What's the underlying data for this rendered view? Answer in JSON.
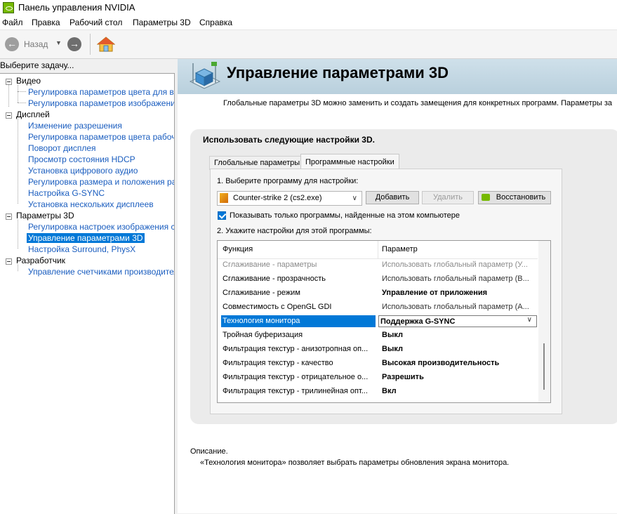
{
  "window": {
    "title": "Панель управления NVIDIA"
  },
  "menu": [
    "Файл",
    "Правка",
    "Рабочий стол",
    "Параметры 3D",
    "Справка"
  ],
  "toolbar": {
    "back_label": "Назад"
  },
  "sidebar": {
    "task_label": "Выберите задачу...",
    "categories": [
      {
        "label": "Видео",
        "items": [
          "Регулировка параметров цвета для вид",
          "Регулировка параметров изображения д"
        ]
      },
      {
        "label": "Дисплей",
        "items": [
          "Изменение разрешения",
          "Регулировка параметров цвета рабочег",
          "Поворот дисплея",
          "Просмотр состояния HDCP",
          "Установка цифрового аудио",
          "Регулировка размера и положения рабо",
          "Настройка G-SYNC",
          "Установка нескольких дисплеев"
        ]
      },
      {
        "label": "Параметры 3D",
        "items": [
          "Регулировка настроек изображения с пр",
          "Управление параметрами 3D",
          "Настройка Surround, PhysX"
        ]
      },
      {
        "label": "Разработчик",
        "items": [
          "Управление счетчиками производитель"
        ]
      }
    ],
    "selected_item": "Управление параметрами 3D"
  },
  "main": {
    "title": "Управление параметрами 3D",
    "intro": "Глобальные параметры 3D можно заменить и создать замещения для конкретных программ. Параметры за",
    "panel_heading": "Использовать следующие настройки 3D.",
    "tabs": [
      {
        "label": "Глобальные параметры",
        "active": false
      },
      {
        "label": "Программные настройки",
        "active": true
      }
    ],
    "step1": "1. Выберите программу для настройки:",
    "program_select": "Counter-strike 2 (cs2.exe)",
    "add_button": "Добавить",
    "remove_button": "Удалить",
    "restore_button": "Восстановить",
    "checkbox_label": "Показывать только программы, найденные на этом компьютере",
    "checkbox_checked": true,
    "step2": "2. Укажите настройки для этой программы:",
    "grid": {
      "headers": [
        "Функция",
        "Параметр"
      ],
      "rows": [
        {
          "feature": "Сглаживание - параметры",
          "value": "Использовать глобальный параметр (У...",
          "style": "muted"
        },
        {
          "feature": "Сглаживание - прозрачность",
          "value": "Использовать глобальный параметр (В...",
          "style": "global"
        },
        {
          "feature": "Сглаживание - режим",
          "value": "Управление от приложения",
          "style": "bold"
        },
        {
          "feature": "Совместимость с OpenGL GDI",
          "value": "Использовать глобальный параметр (А...",
          "style": "global"
        },
        {
          "feature": "Технология монитора",
          "value": "Поддержка G-SYNC",
          "style": "selected"
        },
        {
          "feature": "Тройная буферизация",
          "value": "Выкл",
          "style": "bold"
        },
        {
          "feature": "Фильтрация текстур - анизотропная оп...",
          "value": "Выкл",
          "style": "bold"
        },
        {
          "feature": "Фильтрация текстур - качество",
          "value": "Высокая производительность",
          "style": "bold"
        },
        {
          "feature": "Фильтрация текстур - отрицательное о...",
          "value": "Разрешить",
          "style": "bold"
        },
        {
          "feature": "Фильтрация текстур - трилинейная опт...",
          "value": "Вкл",
          "style": "bold"
        }
      ]
    },
    "description_title": "Описание.",
    "description_text": "«Технология монитора» позволяет выбрать параметры обновления экрана монитора."
  },
  "colors": {
    "accent": "#0078d7",
    "link": "#1a5dbf",
    "nvidia_green": "#76b900",
    "header_band": "#c4d8e3"
  },
  "icons": [
    "nvidia-app-icon",
    "back-arrow-icon",
    "forward-arrow-icon",
    "home-icon",
    "3d-cube-settings-icon",
    "game-program-icon",
    "nvidia-restore-icon",
    "chevron-down-icon"
  ]
}
